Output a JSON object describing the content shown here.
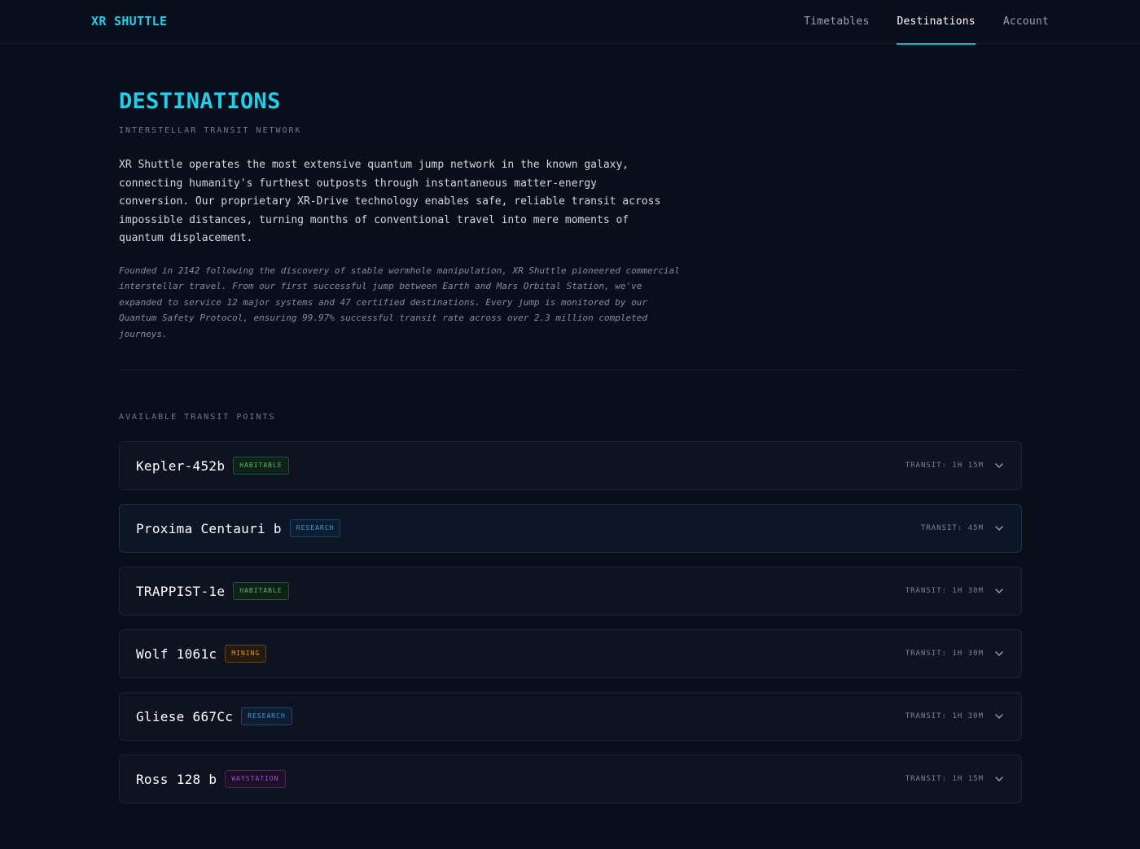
{
  "header": {
    "logo": "XR SHUTTLE",
    "nav": [
      {
        "label": "Timetables",
        "active": false
      },
      {
        "label": "Destinations",
        "active": true
      },
      {
        "label": "Account",
        "active": false
      }
    ]
  },
  "page": {
    "title": "DESTINATIONS",
    "subtitle": "INTERSTELLAR TRANSIT NETWORK",
    "intro": "XR Shuttle operates the most extensive quantum jump network in the known galaxy, connecting humanity's furthest outposts through instantaneous matter-energy conversion. Our proprietary XR-Drive technology enables safe, reliable transit across impossible distances, turning months of conventional travel into mere moments of quantum displacement.",
    "history": "Founded in 2142 following the discovery of stable wormhole manipulation, XR Shuttle pioneered commercial interstellar travel. From our first successful jump between Earth and Mars Orbital Station, we've expanded to service 12 major systems and 47 certified destinations. Every jump is monitored by our Quantum Safety Protocol, ensuring 99.97% successful transit rate across over 2.3 million completed journeys.",
    "section_label": "AVAILABLE TRANSIT POINTS"
  },
  "destinations": [
    {
      "name": "Kepler-452b",
      "tag": "HABITABLE",
      "tag_type": "habitable",
      "transit": "TRANSIT: 1H 15M",
      "highlight": false
    },
    {
      "name": "Proxima Centauri b",
      "tag": "RESEARCH",
      "tag_type": "research",
      "transit": "TRANSIT: 45M",
      "highlight": true
    },
    {
      "name": "TRAPPIST-1e",
      "tag": "HABITABLE",
      "tag_type": "habitable",
      "transit": "TRANSIT: 1H 30M",
      "highlight": false
    },
    {
      "name": "Wolf 1061c",
      "tag": "MINING",
      "tag_type": "mining",
      "transit": "TRANSIT: 1H 30M",
      "highlight": false
    },
    {
      "name": "Gliese 667Cc",
      "tag": "RESEARCH",
      "tag_type": "research",
      "transit": "TRANSIT: 1H 30M",
      "highlight": false
    },
    {
      "name": "Ross 128 b",
      "tag": "WAYSTATION",
      "tag_type": "waystation",
      "transit": "TRANSIT: 1H 15M",
      "highlight": false
    }
  ],
  "colors": {
    "accent": "#1ed0ea",
    "background": "#0a0e1a",
    "habitable": "#4fbf6c",
    "research": "#3a9ae6",
    "mining": "#e09a2a",
    "waystation": "#a24cd1"
  },
  "icons": {
    "expand": "chevron-down-icon"
  }
}
